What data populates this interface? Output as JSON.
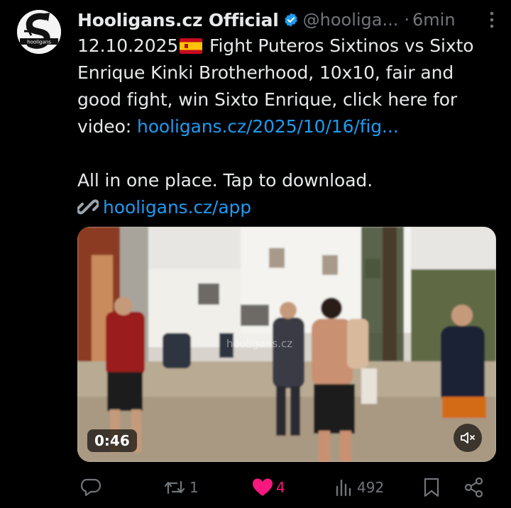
{
  "post": {
    "author_name": "Hooligans.cz Official",
    "handle": "@hooliga...",
    "separator": "·",
    "time": "6min",
    "text_part1": "12.10.2025",
    "text_part2": " Fight Puteros Sixtinos vs Sixto Enrique Kinki Brotherhood, 10x10, fair and good fight, win Sixto Enrique, click here for video: ",
    "video_link": "hooligans.cz/2025/10/16/fig...",
    "promo_text": "All in one place. Tap to download.",
    "app_link": "hooligans.cz/app",
    "avatar_logo_text": "hooligans"
  },
  "video": {
    "duration": "0:46",
    "watermark": "hooligans.cz"
  },
  "actions": {
    "reply_count": "",
    "repost_count": "1",
    "like_count": "4",
    "views_count": "492"
  },
  "colors": {
    "background": "#000000",
    "text": "#e7e9ea",
    "muted": "#71767b",
    "link": "#1d9bf0",
    "like": "#f91880",
    "verified": "#1d9bf0"
  },
  "icons": [
    "verified-badge-icon",
    "more-options-icon",
    "spain-flag-icon",
    "link-emoji-icon",
    "mute-icon",
    "reply-icon",
    "repost-icon",
    "like-icon",
    "views-icon",
    "bookmark-icon",
    "share-icon"
  ]
}
